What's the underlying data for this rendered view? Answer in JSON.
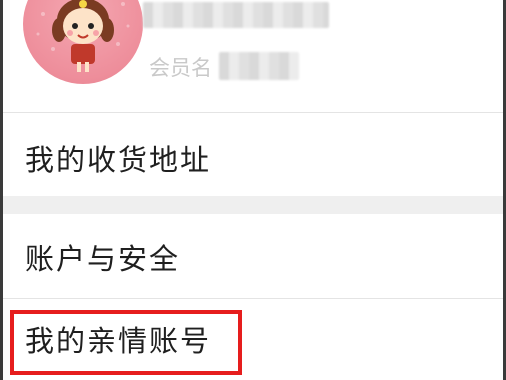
{
  "profile": {
    "member_label": "会员名",
    "avatar_icon": "cartoon-girl-avatar-icon"
  },
  "menu": {
    "address": "我的收货地址",
    "account_security": "账户与安全",
    "family_account": "我的亲情账号"
  },
  "colors": {
    "highlight": "#e61d1d",
    "section_gap": "#efefef",
    "avatar_bg": "#ee8e9b"
  }
}
